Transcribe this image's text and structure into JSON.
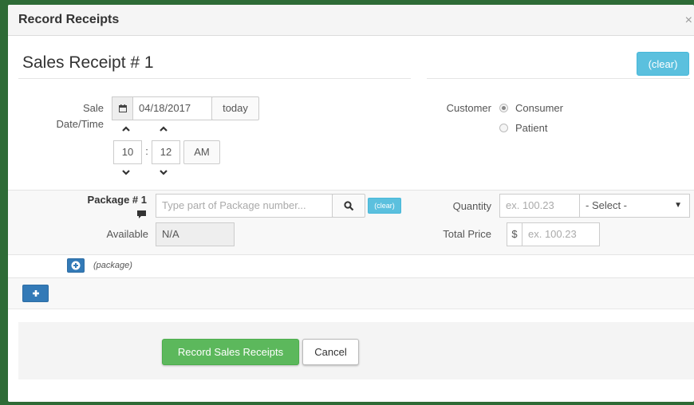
{
  "dialog": {
    "title": "Record Receipts",
    "close": "×"
  },
  "receipt": {
    "title": "Sales Receipt # 1",
    "clear_label": "(clear)"
  },
  "sale_date": {
    "label_line1": "Sale",
    "label_line2": "Date/Time",
    "date_value": "04/18/2017",
    "today_label": "today",
    "hour": "10",
    "separator": ":",
    "minute": "12",
    "ampm": "AM"
  },
  "customer": {
    "label": "Customer",
    "options": [
      {
        "label": "Consumer",
        "selected": true
      },
      {
        "label": "Patient",
        "selected": false
      }
    ]
  },
  "package": {
    "label": "Package # 1",
    "search_placeholder": "Type part of Package number...",
    "clear_label": "(clear)",
    "available_label": "Available",
    "available_value": "N/A",
    "quantity_label": "Quantity",
    "quantity_placeholder": "ex. 100.23",
    "unit_select": "- Select -",
    "total_price_label": "Total Price",
    "currency": "$",
    "price_placeholder": "ex. 100.23",
    "add_package_label": "(package)"
  },
  "footer": {
    "submit_label": "Record Sales Receipts",
    "cancel_label": "Cancel"
  },
  "colors": {
    "info": "#5bc0de",
    "primary": "#337ab7",
    "success": "#5cb85c",
    "page_bg": "#2e6b36"
  },
  "icons": [
    "calendar-icon",
    "chevron-up-icon",
    "chevron-down-icon",
    "comment-icon",
    "search-icon",
    "plus-circle-icon",
    "plus-icon",
    "close-icon"
  ]
}
